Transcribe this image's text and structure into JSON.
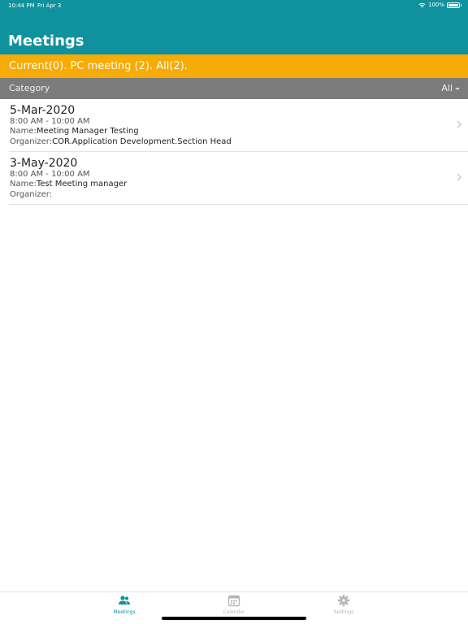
{
  "status_bar": {
    "time": "10:44 PM",
    "date": "Fri Apr 3",
    "battery": "100%"
  },
  "header": {
    "title": "Meetings"
  },
  "filter": {
    "text": "Current(0). PC meeting (2). All(2)."
  },
  "category": {
    "label": "Category",
    "selected": "All"
  },
  "meetings": [
    {
      "date": "5-Mar-2020",
      "time": "8:00 AM - 10:00 AM",
      "name_label": "Name:",
      "name": "Meeting Manager Testing",
      "organizer_label": "Organizer:",
      "organizer": "COR.Application Development.Section Head"
    },
    {
      "date": "3-May-2020",
      "time": "8:00 AM - 10:00 AM",
      "name_label": "Name:",
      "name": "Test Meeting manager",
      "organizer_label": "Organizer:",
      "organizer": ""
    }
  ],
  "tabs": [
    {
      "label": "Meetings",
      "icon": "people-icon",
      "active": true
    },
    {
      "label": "Calendar",
      "icon": "calendar-icon",
      "active": false
    },
    {
      "label": "Settings",
      "icon": "gear-icon",
      "active": false
    }
  ],
  "colors": {
    "header": "#0f929d",
    "filter_bar": "#f6ab06",
    "category_bar": "#7b7b7b"
  }
}
